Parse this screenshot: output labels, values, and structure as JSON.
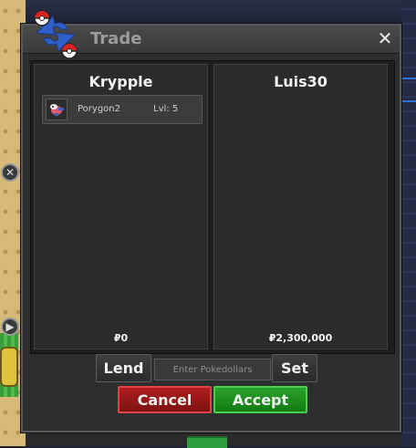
{
  "window": {
    "title": "Trade",
    "close_icon": "close-icon"
  },
  "left_panel": {
    "player": "Krypple",
    "money": "₽0",
    "items": [
      {
        "icon": "porygon2-sprite",
        "name": "Porygon2",
        "level": "Lvl: 5"
      }
    ]
  },
  "right_panel": {
    "player": "Luis30",
    "money": "₽2,300,000"
  },
  "controls": {
    "lend_label": "Lend",
    "pokedollars_placeholder": "Enter Pokedollars",
    "set_label": "Set",
    "cancel_label": "Cancel",
    "accept_label": "Accept"
  },
  "side_buttons": [
    {
      "icon": "close-icon",
      "glyph": "✕"
    },
    {
      "icon": "play-icon",
      "glyph": "▶"
    }
  ],
  "colors": {
    "cancel": "#9a1a1a",
    "accept": "#1f8f1f",
    "panel_bg": "#2b2b2b"
  }
}
